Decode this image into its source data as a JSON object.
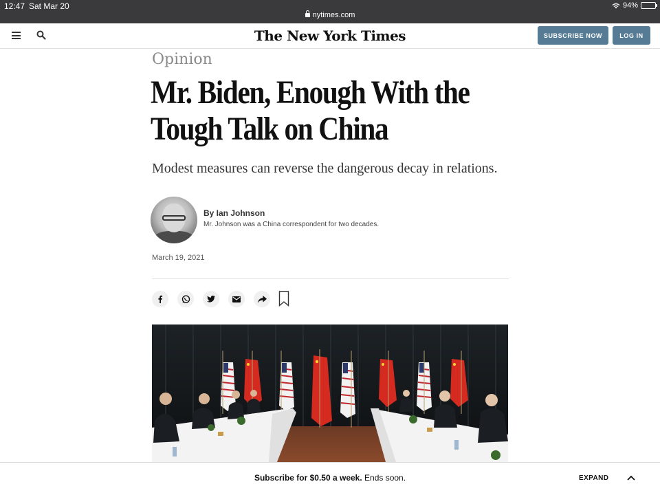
{
  "status_bar": {
    "time": "12:47",
    "date": "Sat Mar 20",
    "url": "nytimes.com",
    "battery": "94%",
    "battery_level": 0.94
  },
  "masthead": {
    "logo": "The New York Times",
    "subscribe_label": "SUBSCRIBE NOW",
    "login_label": "LOG IN",
    "button_color": "#567b95"
  },
  "article": {
    "kicker": "Opinion",
    "headline": "Mr. Biden, Enough With the Tough Talk on China",
    "summary": "Modest measures can reverse the dangerous decay in relations.",
    "byline": "By Ian Johnson",
    "bio": "Mr. Johnson was a China correspondent for two decades.",
    "date": "March 19, 2021",
    "share_icons": [
      "facebook-icon",
      "whatsapp-icon",
      "twitter-icon",
      "email-icon",
      "share-icon",
      "bookmark-icon"
    ]
  },
  "bottom_bar": {
    "promo_bold": "Subscribe for $0.50 a week.",
    "promo_rest": " Ends soon.",
    "expand_label": "EXPAND"
  }
}
